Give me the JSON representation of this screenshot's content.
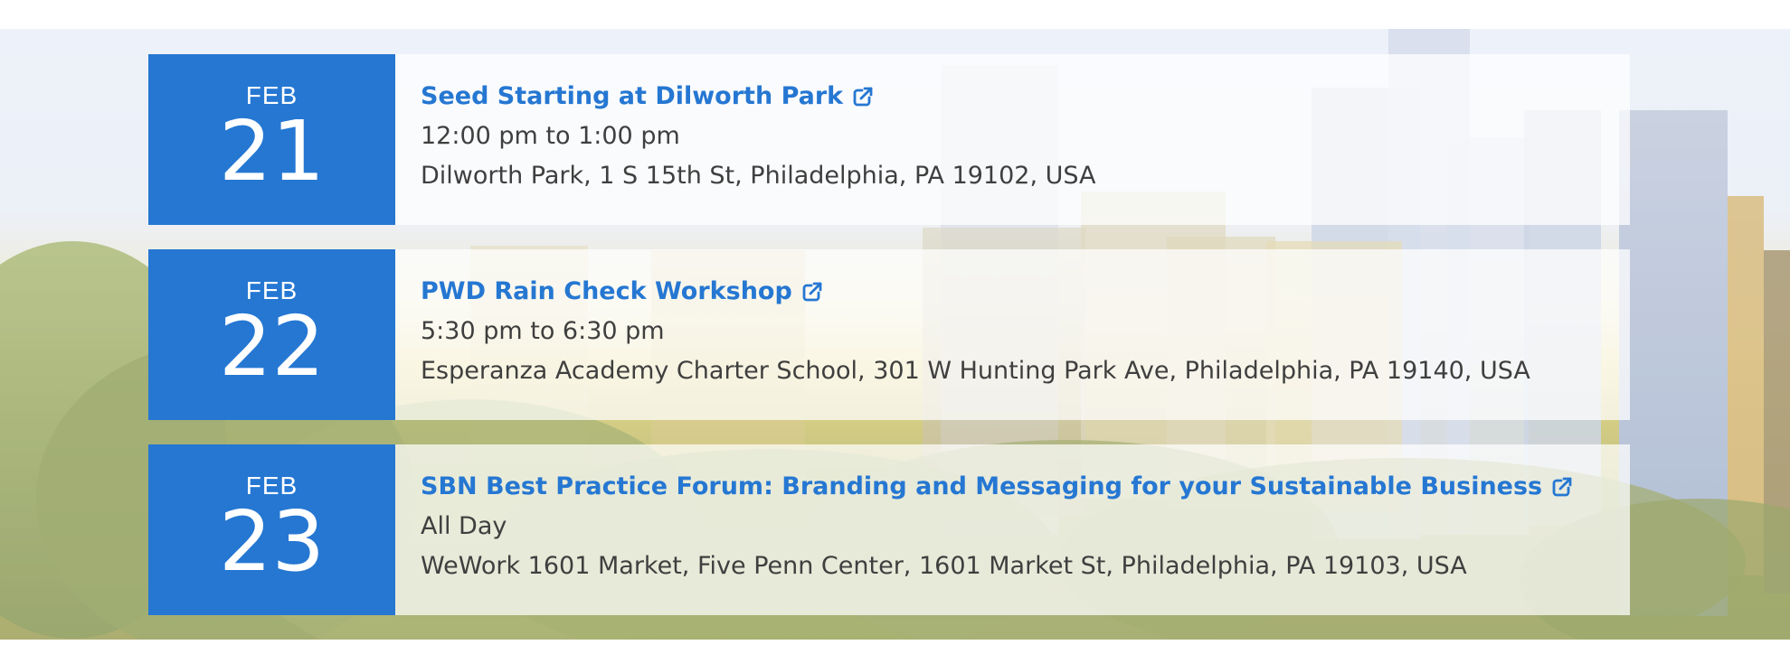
{
  "events": [
    {
      "month": "FEB",
      "day": "21",
      "title": "Seed Starting at Dilworth Park",
      "time": "12:00 pm to 1:00 pm",
      "location": "Dilworth Park, 1 S 15th St, Philadelphia, PA 19102, USA",
      "icon": "external-link-icon"
    },
    {
      "month": "FEB",
      "day": "22",
      "title": "PWD Rain Check Workshop",
      "time": "5:30 pm to 6:30 pm",
      "location": "Esperanza Academy Charter School, 301 W Hunting Park Ave, Philadelphia, PA 19140, USA",
      "icon": "external-link-icon"
    },
    {
      "month": "FEB",
      "day": "23",
      "title": "SBN Best Practice Forum: Branding and Messaging for your Sustainable Business",
      "time": "All Day",
      "location": "WeWork 1601 Market, Five Penn Center, 1601 Market St, Philadelphia, PA 19103, USA",
      "icon": "external-link-icon"
    }
  ],
  "colors": {
    "accent": "#2577d2",
    "text": "#3f3f3f",
    "card_bg": "rgba(255,255,255,0.72)"
  }
}
